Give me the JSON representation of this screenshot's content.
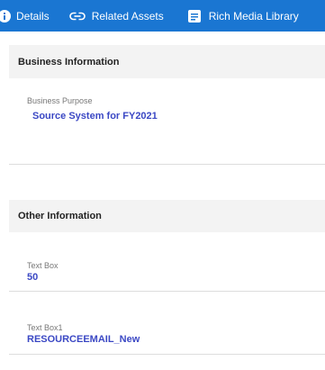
{
  "tabs": [
    {
      "label": "Details",
      "icon": "info-icon"
    },
    {
      "label": "Related Assets",
      "icon": "link-icon"
    },
    {
      "label": "Rich Media Library",
      "icon": "document-icon"
    }
  ],
  "sections": {
    "business": {
      "title": "Business Information",
      "fields": [
        {
          "label": "Business Purpose",
          "value": "Source System for FY2021"
        }
      ]
    },
    "other": {
      "title": "Other Information",
      "fields": [
        {
          "label": "Text Box",
          "value": "50"
        },
        {
          "label": "Text Box1",
          "value": "RESOURCEEMAIL_New"
        }
      ]
    }
  },
  "colors": {
    "tabbar_bg": "#1a76d2",
    "header_bg": "#f3f3f3",
    "value_text": "#3b48c4",
    "label_text": "#777777"
  }
}
